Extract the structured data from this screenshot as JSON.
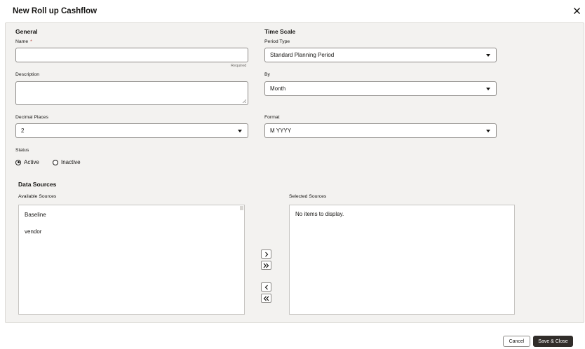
{
  "dialog": {
    "title": "New Roll up Cashflow",
    "close_icon": "close-icon"
  },
  "general": {
    "heading": "General",
    "name_label": "Name",
    "required_mark": "*",
    "name_value": "",
    "name_hint": "Required",
    "description_label": "Description",
    "description_value": "",
    "decimal_label": "Decimal Places",
    "decimal_value": "2",
    "status_label": "Status",
    "status_options": [
      {
        "label": "Active",
        "selected": true
      },
      {
        "label": "Inactive",
        "selected": false
      }
    ]
  },
  "time_scale": {
    "heading": "Time Scale",
    "period_type_label": "Period Type",
    "period_type_value": "Standard Planning Period",
    "by_label": "By",
    "by_value": "Month",
    "format_label": "Format",
    "format_value": "M YYYY"
  },
  "data_sources": {
    "heading": "Data Sources",
    "available_label": "Available Sources",
    "available_items": [
      "Baseline",
      "vendor"
    ],
    "selected_label": "Selected Sources",
    "empty_text": "No items to display."
  },
  "footer": {
    "cancel_label": "Cancel",
    "save_label": "Save & Close"
  },
  "colors": {
    "panel": "#f3f2f0",
    "primary": "#312d2a",
    "required": "#b3261e"
  }
}
